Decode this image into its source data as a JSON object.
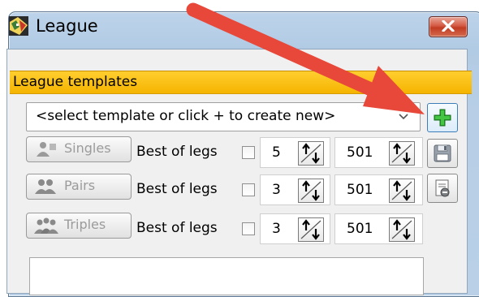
{
  "window": {
    "title": "League",
    "icon": "darts-league-icon",
    "close_icon": "close-icon"
  },
  "templates": {
    "section_title": "League templates",
    "select_value": "<select template or click + to create new>",
    "add_icon": "add-icon",
    "save_icon": "save-icon",
    "copy_icon": "copy-template-icon"
  },
  "game_modes": [
    {
      "label": "Singles",
      "icon": "singles-player-icon",
      "best_of_label": "Best of legs",
      "checked": false,
      "legs": "5",
      "score": "501"
    },
    {
      "label": "Pairs",
      "icon": "pairs-players-icon",
      "best_of_label": "Best of legs",
      "checked": false,
      "legs": "3",
      "score": "501"
    },
    {
      "label": "Triples",
      "icon": "triples-players-icon",
      "best_of_label": "Best of legs",
      "checked": false,
      "legs": "3",
      "score": "501"
    }
  ],
  "annotation": {
    "icon": "red-arrow-icon",
    "color": "#e8483a"
  },
  "colors": {
    "section_bar": "#f5b400",
    "close_button": "#c94a31",
    "add_plus": "#2aa02a"
  }
}
